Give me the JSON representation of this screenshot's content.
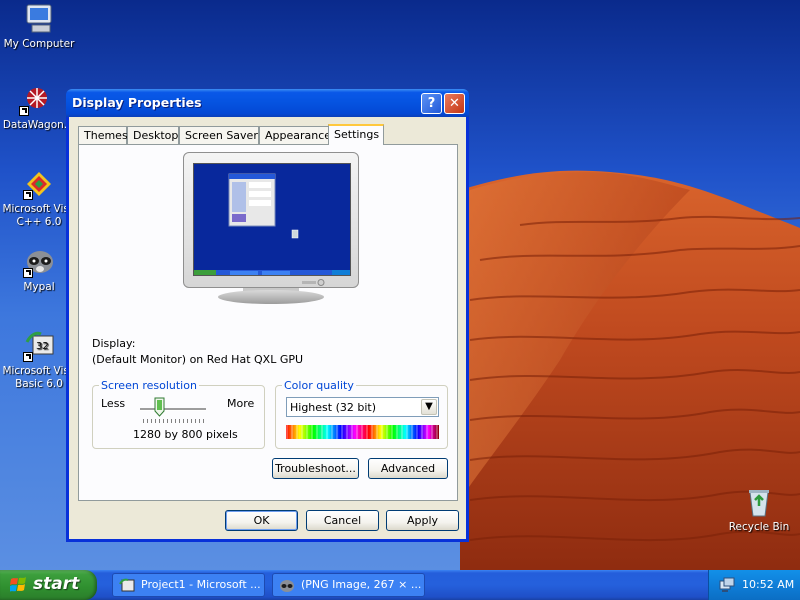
{
  "desktop": {
    "icons": [
      {
        "label": "My Computer",
        "icon": "my-computer-icon"
      },
      {
        "label": "DataWagon.",
        "icon": "datawagon-icon"
      },
      {
        "label": "Microsoft Visual C++ 6.0",
        "line1": "Microsoft Visu",
        "line2": "C++ 6.0",
        "icon": "visual-cpp-icon"
      },
      {
        "label": "Mypal",
        "icon": "mypal-raccoon-icon"
      },
      {
        "label": "Microsoft Visual Basic 6.0",
        "line1": "Microsoft Visu",
        "line2": "Basic 6.0",
        "icon": "visual-basic-icon"
      },
      {
        "label": "Recycle Bin",
        "icon": "recycle-bin-icon"
      }
    ]
  },
  "window": {
    "title": "Display Properties",
    "help_glyph": "?",
    "close_glyph": "✕",
    "tabs": [
      {
        "label": "Themes",
        "active": false
      },
      {
        "label": "Desktop",
        "active": false
      },
      {
        "label": "Screen Saver",
        "active": false
      },
      {
        "label": "Appearance",
        "active": false
      },
      {
        "label": "Settings",
        "active": true
      }
    ],
    "settings": {
      "display_label": "Display:",
      "display_value": "(Default Monitor) on Red Hat QXL GPU",
      "resolution": {
        "title": "Screen resolution",
        "less": "Less",
        "more": "More",
        "value_text": "1280 by 800 pixels",
        "slider_position": 0.3
      },
      "color_quality": {
        "title": "Color quality",
        "selected": "Highest (32 bit)",
        "dropdown_glyph": "▼"
      },
      "troubleshoot_label": "Troubleshoot...",
      "advanced_label": "Advanced"
    },
    "buttons": {
      "ok": "OK",
      "cancel": "Cancel",
      "apply": "Apply"
    }
  },
  "taskbar": {
    "start_label": "start",
    "tasks": [
      {
        "label": "Project1 - Microsoft ...",
        "icon": "visual-basic-icon"
      },
      {
        "label": "(PNG Image, 267 × ...",
        "icon": "mypal-raccoon-icon"
      }
    ],
    "clock": "10:52 AM",
    "tray_icon": "tray-network-icon"
  },
  "colors": {
    "titlebar_blue": "#0553e0",
    "window_face": "#ece9d8",
    "group_title": "#0046d5",
    "start_green": "#3c9e3c",
    "taskbar_blue": "#245edb",
    "desert_red": "#c4461e"
  }
}
